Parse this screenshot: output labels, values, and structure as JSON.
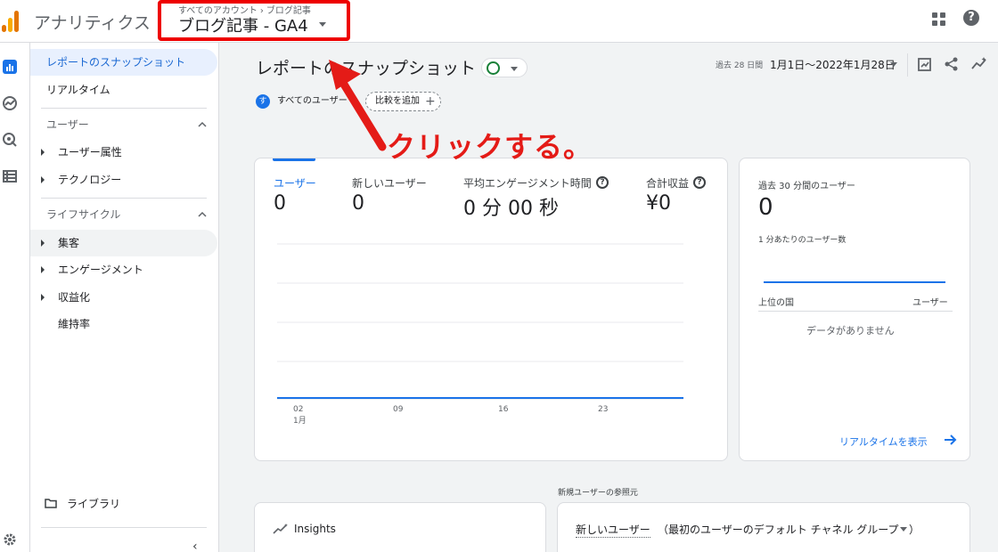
{
  "header": {
    "app_title": "アナリティクス",
    "breadcrumb_account": "すべてのアカウント",
    "breadcrumb_sep": "›",
    "breadcrumb_property": "ブログ記事",
    "property_name": "ブログ記事 - GA4",
    "help_glyph": "?"
  },
  "nav": {
    "snapshot": "レポートのスナップショット",
    "realtime": "リアルタイム",
    "user_section": "ユーザー",
    "user_attributes": "ユーザー属性",
    "technology": "テクノロジー",
    "lifecycle_section": "ライフサイクル",
    "acquisition": "集客",
    "engagement": "エンゲージメント",
    "monetization": "収益化",
    "retention": "維持率",
    "library": "ライブラリ",
    "collapse_glyph": "‹"
  },
  "page": {
    "title": "レポートのスナップショット",
    "date_prefix": "過去 28 日間",
    "date_range": "1月1日〜2022年1月28日",
    "segment_avatar": "す",
    "segment": "すべてのユーザー",
    "add_comparison": "比較を追加",
    "add_plus": "+"
  },
  "annotation": "クリックする。",
  "metrics": [
    {
      "label": "ユーザー",
      "value": "0"
    },
    {
      "label": "新しいユーザー",
      "value": "0"
    },
    {
      "label": "平均エンゲージメント時間",
      "value": "0 分 00 秒"
    },
    {
      "label": "合計収益",
      "value": "¥0"
    }
  ],
  "chart_data": {
    "type": "line",
    "x_ticks": [
      "02",
      "09",
      "16",
      "23"
    ],
    "x_tick_sub": [
      "1月",
      "",
      "",
      ""
    ],
    "series": [
      {
        "values": [
          0,
          0,
          0,
          0
        ]
      }
    ],
    "grid": true
  },
  "realtime_card": {
    "label": "過去 30 分間のユーザー",
    "value": "0",
    "sub": "1 分あたりのユーザー数",
    "col_country": "上位の国",
    "col_users": "ユーザー",
    "empty": "データがありません",
    "link": "リアルタイムを表示"
  },
  "bottom": {
    "section_label": "新規ユーザーの参照元",
    "insights": "Insights",
    "source_metric": "新しいユーザー",
    "source_dimension": "（最初のユーザーのデフォルト チャネル グループ",
    "source_close": "）"
  },
  "colors": {
    "accent": "#1a73e8",
    "annotation": "#e41b17",
    "logo_orange": "#e37400",
    "logo_yellow": "#f9ab00"
  }
}
